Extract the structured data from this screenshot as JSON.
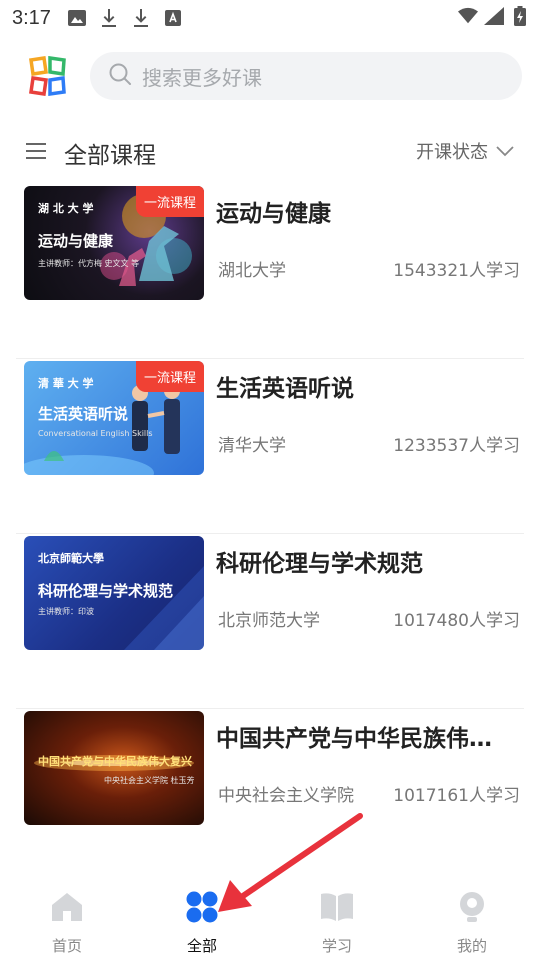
{
  "status_bar": {
    "time": "3:17"
  },
  "search": {
    "placeholder": "搜索更多好课"
  },
  "section": {
    "title": "全部课程",
    "filter_label": "开课状态"
  },
  "courses": [
    {
      "title": "运动与健康",
      "university": "湖北大学",
      "learners": "1543321人学习",
      "badge": "一流课程",
      "thumb_title": "运动与健康",
      "thumb_school": "湖 北 大 学",
      "thumb_teacher": "主讲教师：代方梅 史文文 等"
    },
    {
      "title": "生活英语听说",
      "university": "清华大学",
      "learners": "1233537人学习",
      "badge": "一流课程",
      "thumb_title": "生活英语听说",
      "thumb_school": "清 華 大 学",
      "thumb_subtitle": "Conversational English Skills"
    },
    {
      "title": "科研伦理与学术规范",
      "university": "北京师范大学",
      "learners": "1017480人学习",
      "thumb_title": "科研伦理与学术规范",
      "thumb_school": "北京師範大學",
      "thumb_teacher": "主讲教师：印波"
    },
    {
      "title": "中国共产党与中华民族伟…",
      "university": "中央社会主义学院",
      "learners": "1017161人学习",
      "thumb_title": "中国共产党与中华民族伟大复兴",
      "thumb_teacher": "中央社会主义学院  杜玉芳"
    }
  ],
  "bottom_nav": [
    {
      "label": "首页",
      "icon": "home-icon",
      "active": false
    },
    {
      "label": "全部",
      "icon": "grid-icon",
      "active": true
    },
    {
      "label": "学习",
      "icon": "book-icon",
      "active": false
    },
    {
      "label": "我的",
      "icon": "profile-icon",
      "active": false
    }
  ],
  "colors": {
    "accent": "#1a6cf0",
    "badge": "#f04134",
    "annotation_arrow": "#e8323c",
    "inactive_icon": "#d4d6d9"
  }
}
